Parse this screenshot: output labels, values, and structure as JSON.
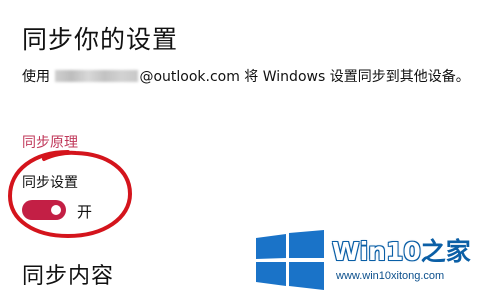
{
  "page": {
    "title": "同步你的设置",
    "description_prefix": "使用 ",
    "description_email_domain": "@outlook.com",
    "description_suffix": " 将 Windows 设置同步到其他设备。",
    "link_label": "同步原理"
  },
  "sync_setting": {
    "label": "同步设置",
    "state_label": "开",
    "enabled": true,
    "accent_color": "#c31f45"
  },
  "section": {
    "title": "同步内容"
  },
  "annotation": {
    "circle_color": "#d4141c"
  },
  "watermark": {
    "brand_win": "Win10",
    "brand_zh": "之家",
    "url": "www.win10xitong.com",
    "logo_color": "#1a73c8"
  }
}
